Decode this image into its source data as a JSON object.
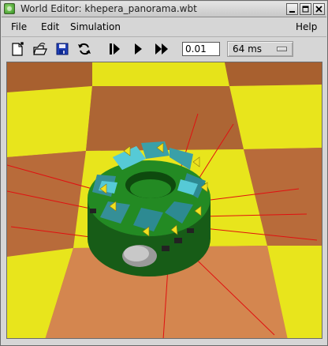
{
  "window": {
    "title": "World Editor: khepera_panorama.wbt"
  },
  "menubar": {
    "file": "File",
    "edit": "Edit",
    "simulation": "Simulation",
    "help": "Help"
  },
  "toolbar": {
    "time_step_value": "0.01",
    "refresh_rate": "64 ms"
  },
  "icons": {
    "new": "new-file-icon",
    "open": "open-folder-icon",
    "save": "floppy-disk-icon",
    "revert": "reload-icon",
    "step": "step-icon",
    "run": "play-icon",
    "fast": "fast-forward-icon"
  },
  "colors": {
    "floor_yellow": "#e8e41a",
    "floor_brown": "#b8683a",
    "robot_green": "#1f7a1f",
    "robot_cyan": "#3aa0a8",
    "sensor_rays": "#e01010",
    "save_icon_blue": "#1f3fb8"
  }
}
